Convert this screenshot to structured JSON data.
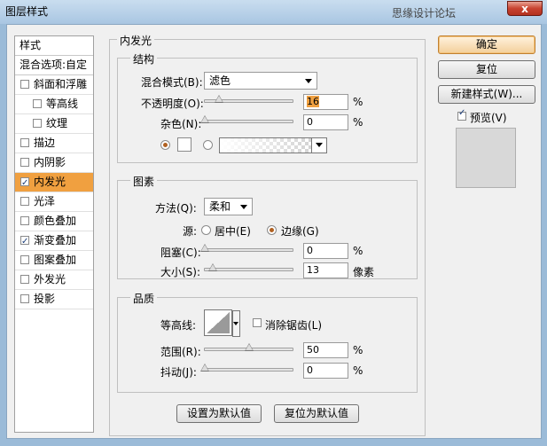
{
  "window": {
    "title": "图层样式",
    "watermark": "思缘设计论坛",
    "close_label": "x"
  },
  "styles_panel": {
    "header": "样式",
    "blend_options": "混合选项:自定",
    "items": [
      {
        "label": "斜面和浮雕",
        "checked": false,
        "sub": false,
        "active": false
      },
      {
        "label": "等高线",
        "checked": false,
        "sub": true,
        "active": false
      },
      {
        "label": "纹理",
        "checked": false,
        "sub": true,
        "active": false
      },
      {
        "label": "描边",
        "checked": false,
        "sub": false,
        "active": false
      },
      {
        "label": "内阴影",
        "checked": false,
        "sub": false,
        "active": false
      },
      {
        "label": "内发光",
        "checked": true,
        "sub": false,
        "active": true
      },
      {
        "label": "光泽",
        "checked": false,
        "sub": false,
        "active": false
      },
      {
        "label": "颜色叠加",
        "checked": false,
        "sub": false,
        "active": false
      },
      {
        "label": "渐变叠加",
        "checked": true,
        "sub": false,
        "active": false
      },
      {
        "label": "图案叠加",
        "checked": false,
        "sub": false,
        "active": false
      },
      {
        "label": "外发光",
        "checked": false,
        "sub": false,
        "active": false
      },
      {
        "label": "投影",
        "checked": false,
        "sub": false,
        "active": false
      }
    ]
  },
  "inner_glow": {
    "title": "内发光",
    "structure": {
      "title": "结构",
      "blend_mode_label": "混合模式(B):",
      "blend_mode_value": "滤色",
      "opacity_label": "不透明度(O):",
      "opacity_value": "16",
      "noise_label": "杂色(N):",
      "noise_value": "0",
      "percent": "%"
    },
    "elements": {
      "title": "图素",
      "technique_label": "方法(Q):",
      "technique_value": "柔和",
      "source_label": "源:",
      "source_center": "居中(E)",
      "source_edge": "边缘(G)",
      "choke_label": "阻塞(C):",
      "choke_value": "0",
      "size_label": "大小(S):",
      "size_value": "13",
      "size_unit": "像素",
      "percent": "%"
    },
    "quality": {
      "title": "品质",
      "contour_label": "等高线:",
      "antialias_label": "消除锯齿(L)",
      "range_label": "范围(R):",
      "range_value": "50",
      "jitter_label": "抖动(J):",
      "jitter_value": "0",
      "percent": "%"
    },
    "make_default": "设置为默认值",
    "reset_default": "复位为默认值"
  },
  "buttons": {
    "ok": "确定",
    "reset": "复位",
    "new_style": "新建样式(W)...",
    "preview": "预览(V)"
  },
  "sliders": {
    "opacity": 16,
    "noise": 0,
    "choke": 0,
    "size": 13,
    "range": 50,
    "jitter": 0
  }
}
